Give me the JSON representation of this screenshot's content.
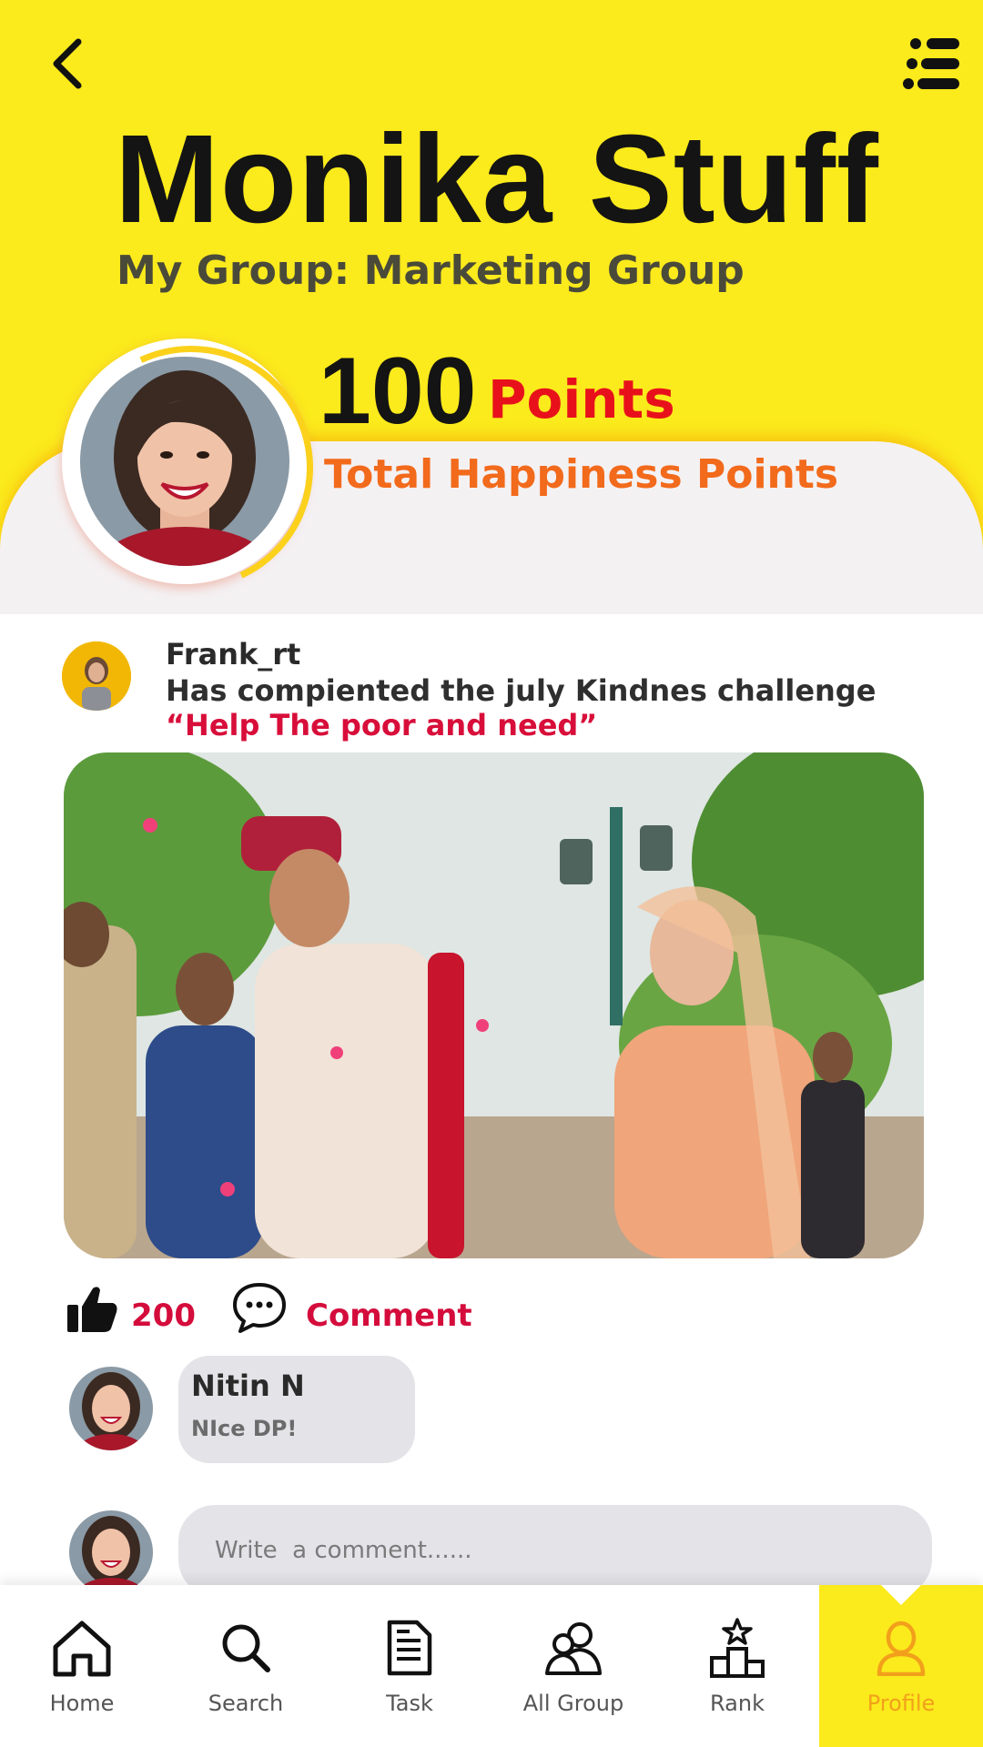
{
  "header": {
    "title": "Monika Stuff",
    "group_line": "My Group: Marketing Group",
    "points_value": "100",
    "points_unit": "Points",
    "points_caption": "Total Happiness Points"
  },
  "post": {
    "user": "Frank_rt",
    "text": "Has compiented the july Kindnes challenge",
    "quote": "“Help The poor and need”",
    "likes": "200",
    "comment_label": "Comment"
  },
  "comments": [
    {
      "name": "Nitin N",
      "text": "NIce DP!"
    }
  ],
  "composer": {
    "placeholder": "Write  a comment......"
  },
  "nav": [
    {
      "label": "Home",
      "icon": "home-icon"
    },
    {
      "label": "Search",
      "icon": "search-icon"
    },
    {
      "label": "Task",
      "icon": "document-icon"
    },
    {
      "label": "All Group",
      "icon": "group-icon"
    },
    {
      "label": "Rank",
      "icon": "podium-star-icon"
    },
    {
      "label": "Profile",
      "icon": "user-icon",
      "active": true
    }
  ],
  "colors": {
    "brand_yellow": "#fbea1c",
    "accent_red": "#d80e3a",
    "accent_orange": "#f26a1b"
  }
}
